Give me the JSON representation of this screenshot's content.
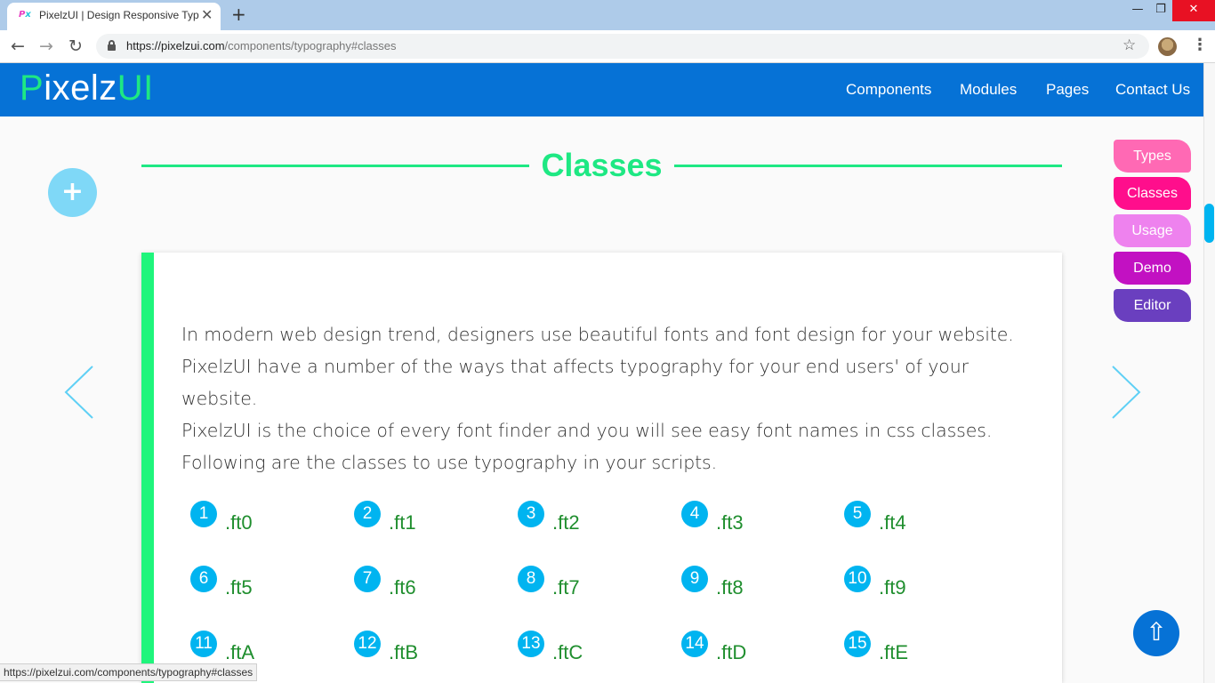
{
  "browser": {
    "tab_title": "PixelzUI | Design Responsive Typ",
    "url_host": "https://pixelzui.com",
    "url_path": "/components/typography#classes",
    "status_url": "https://pixelzui.com/components/typography#classes"
  },
  "site": {
    "logo_part1": "P",
    "logo_part2": "ixelz",
    "logo_part3": "UI",
    "nav": [
      {
        "label": "Components"
      },
      {
        "label": "Modules"
      },
      {
        "label": "Pages"
      },
      {
        "label": "Contact Us"
      }
    ]
  },
  "section": {
    "title": "Classes",
    "intro": [
      "In modern web design trend, designers use beautiful fonts and font design for your website.",
      "PixelzUI have a number of the ways that affects typography for your end users' of your website.",
      "PixelzUI is the choice of every font finder and you will see easy font names in css classes.",
      "Following are the classes to use typography in your scripts."
    ]
  },
  "side_tabs": [
    {
      "label": "Types",
      "color": "#ff69b4"
    },
    {
      "label": "Classes",
      "color": "#ff0e8c"
    },
    {
      "label": "Usage",
      "color": "#ee82ee"
    },
    {
      "label": "Demo",
      "color": "#c211c2"
    },
    {
      "label": "Editor",
      "color": "#6a3fbf"
    }
  ],
  "classes": [
    {
      "num": "1",
      "name": ".ft0"
    },
    {
      "num": "2",
      "name": ".ft1"
    },
    {
      "num": "3",
      "name": ".ft2"
    },
    {
      "num": "4",
      "name": ".ft3"
    },
    {
      "num": "5",
      "name": ".ft4"
    },
    {
      "num": "6",
      "name": ".ft5"
    },
    {
      "num": "7",
      "name": ".ft6"
    },
    {
      "num": "8",
      "name": ".ft7"
    },
    {
      "num": "9",
      "name": ".ft8"
    },
    {
      "num": "10",
      "name": ".ft9"
    },
    {
      "num": "11",
      "name": ".ftA"
    },
    {
      "num": "12",
      "name": ".ftB"
    },
    {
      "num": "13",
      "name": ".ftC"
    },
    {
      "num": "14",
      "name": ".ftD"
    },
    {
      "num": "15",
      "name": ".ftE"
    }
  ],
  "icons": {
    "plus": "+",
    "scroll_top": "⇧"
  }
}
